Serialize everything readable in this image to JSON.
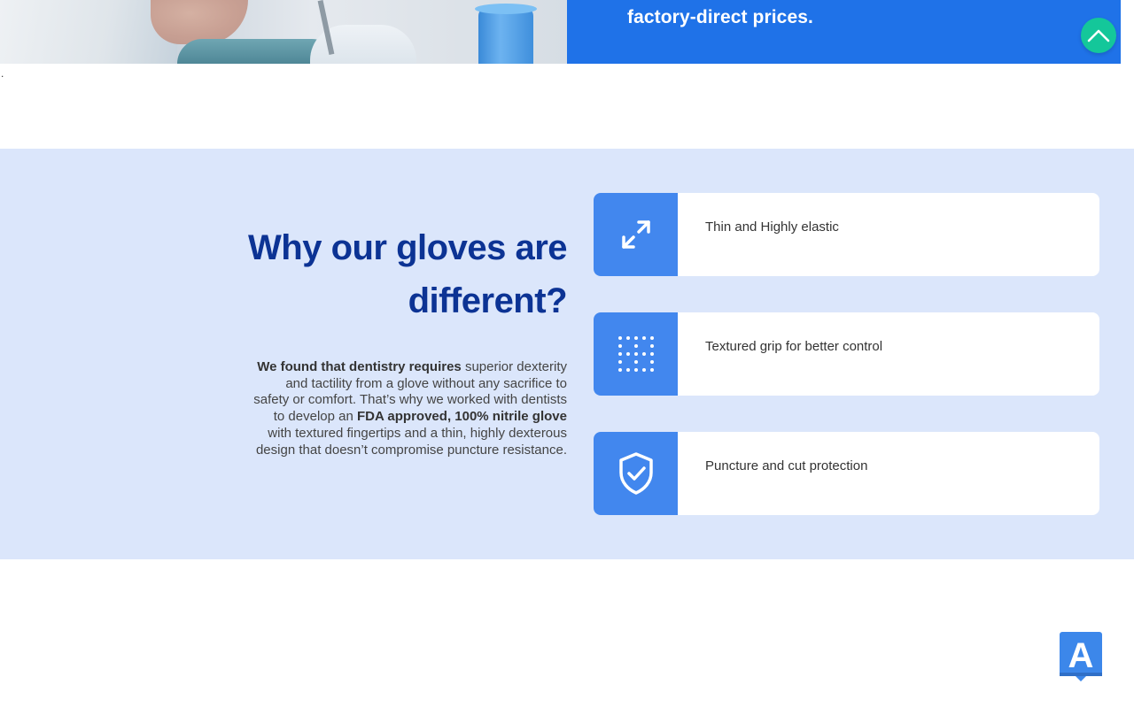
{
  "hero": {
    "tagline": "factory-direct prices."
  },
  "stray_text": ".",
  "scroll_top": {
    "icon": "chevron-up-icon",
    "color": "#14c79a"
  },
  "features": {
    "background": "#dbe6fb",
    "heading_line1": "Why our gloves are",
    "heading_line2": "different?",
    "body": {
      "bold1": "We found that dentistry requires",
      "text1": " superior dexterity and tactility from a glove without any sacrifice to safety or comfort. That’s why we worked with dentists to develop an ",
      "bold2": "FDA approved, 100% nitrile glove",
      "text2": " with textured fingertips and a thin, highly dexterous design that doesn’t compromise puncture resistance."
    },
    "items": [
      {
        "label": "Thin and Highly elastic",
        "icon": "expand-arrows-icon"
      },
      {
        "label": "Textured grip for better control",
        "icon": "dot-grid-icon"
      },
      {
        "label": "Puncture and cut protection",
        "icon": "shield-check-icon"
      }
    ],
    "accent": "#4287ee"
  },
  "app_badge": {
    "letter": "A",
    "icon": "app-a-icon",
    "color": "#3c87ea"
  }
}
